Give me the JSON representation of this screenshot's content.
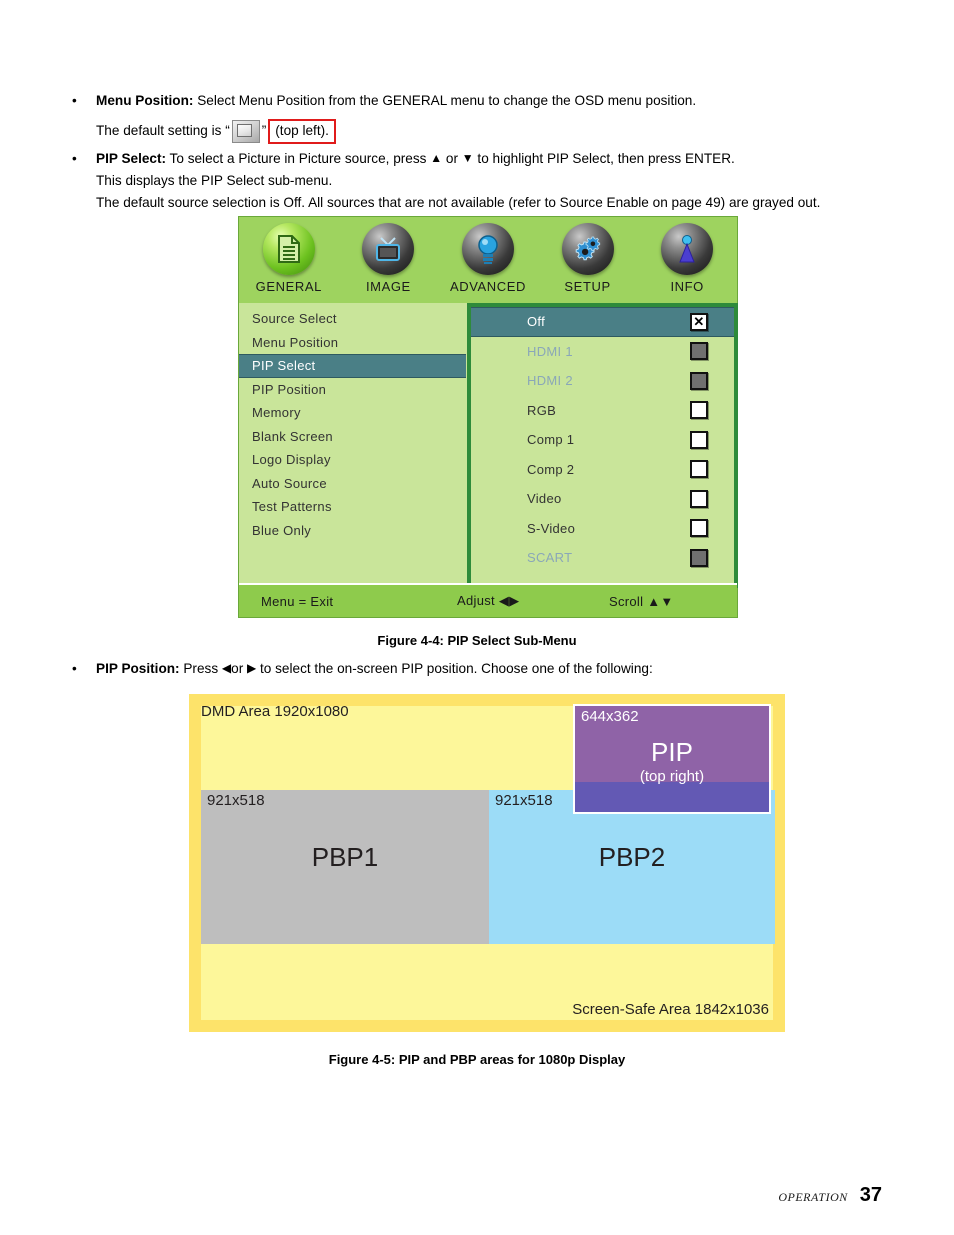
{
  "body_text": {
    "bullet1": {
      "lead": "Menu Position:",
      "text": " Select Menu Position from the GENERAL menu to change the OSD menu position.",
      "default_prefix": "The default setting is “",
      "default_suffix": "”",
      "default_note": "(top left).",
      "icon": "menu-position-top-left-icon"
    },
    "bullet2": {
      "lead": "PIP Select:",
      "text_a": " To select a Picture in Picture source, press ",
      "up_arrow": "▲",
      "text_b": " or ",
      "down_arrow": "▼",
      "text_c": " to highlight PIP Select, then press ENTER.",
      "line2": "This displays the PIP Select sub-menu.",
      "line3": "The default source selection is Off. All sources that are not available (refer to Source Enable on page 49) are grayed out."
    },
    "bullet3": {
      "lead": "PIP Position:",
      "text_a": " Press ",
      "left_arrow": "◀",
      "text_b": "or ",
      "right_arrow": "▶",
      "text_c": " to select the on-screen PIP position. Choose one of the following:"
    }
  },
  "osd": {
    "tabs": [
      {
        "label": "GENERAL",
        "icon": "document-icon",
        "active": true
      },
      {
        "label": "IMAGE",
        "icon": "television-icon",
        "active": false
      },
      {
        "label": "ADVANCED",
        "icon": "lightbulb-icon",
        "active": false
      },
      {
        "label": "SETUP",
        "icon": "gears-icon",
        "active": false
      },
      {
        "label": "INFO",
        "icon": "info-beacon-icon",
        "active": false
      }
    ],
    "menu_items": [
      {
        "label": "Source Select",
        "selected": false
      },
      {
        "label": "Menu Position",
        "selected": false
      },
      {
        "label": "PIP Select",
        "selected": true
      },
      {
        "label": "PIP Position",
        "selected": false
      },
      {
        "label": "Memory",
        "selected": false
      },
      {
        "label": "Blank Screen",
        "selected": false
      },
      {
        "label": "Logo Display",
        "selected": false
      },
      {
        "label": "Auto Source",
        "selected": false
      },
      {
        "label": "Test Patterns",
        "selected": false
      },
      {
        "label": "Blue Only",
        "selected": false
      }
    ],
    "submenu_options": [
      {
        "label": "Off",
        "state": "checked",
        "enabled": true,
        "highlighted": true
      },
      {
        "label": "HDMI 1",
        "state": "disabled",
        "enabled": false,
        "highlighted": false
      },
      {
        "label": "HDMI 2",
        "state": "disabled",
        "enabled": false,
        "highlighted": false
      },
      {
        "label": "RGB",
        "state": "unchecked",
        "enabled": true,
        "highlighted": false
      },
      {
        "label": "Comp 1",
        "state": "unchecked",
        "enabled": true,
        "highlighted": false
      },
      {
        "label": "Comp 2",
        "state": "unchecked",
        "enabled": true,
        "highlighted": false
      },
      {
        "label": "Video",
        "state": "unchecked",
        "enabled": true,
        "highlighted": false
      },
      {
        "label": "S-Video",
        "state": "unchecked",
        "enabled": true,
        "highlighted": false
      },
      {
        "label": "SCART",
        "state": "disabled",
        "enabled": false,
        "highlighted": false
      }
    ],
    "footer": {
      "exit": "Menu = Exit",
      "adjust": "Adjust ◀▶",
      "scroll": "Scroll ▲▼"
    },
    "colors": {
      "header_green": "#9ed35f",
      "panel_green": "#c9e59a",
      "highlight_teal": "#4a7f86",
      "frame_green": "#2e8b3a",
      "footer_green": "#8ecb4c"
    }
  },
  "figure_4_4_caption": "Figure 4-4: PIP Select Sub-Menu",
  "figure_4_5_caption": "Figure 4-5: PIP and PBP areas for 1080p Display",
  "diagram": {
    "dmd_label": "DMD Area 1920x1080",
    "safe_label": "Screen-Safe Area 1842x1036",
    "pbp1": {
      "dims": "921x518",
      "title": "PBP1"
    },
    "pbp2": {
      "dims": "921x518",
      "title": "PBP2"
    },
    "pip": {
      "dims": "644x362",
      "title": "PIP",
      "sub": "(top right)"
    },
    "colors": {
      "outer_yellow": "#fde36a",
      "inner_yellow": "#fdf79a",
      "pbp1_grey": "#bebebe",
      "pbp2_blue": "#9cdcf7",
      "pip_purple": "#8f63a7",
      "pip_lower_purple": "#6359b4"
    }
  },
  "page_footer": {
    "section": "OPERATION",
    "page_number": "37"
  }
}
